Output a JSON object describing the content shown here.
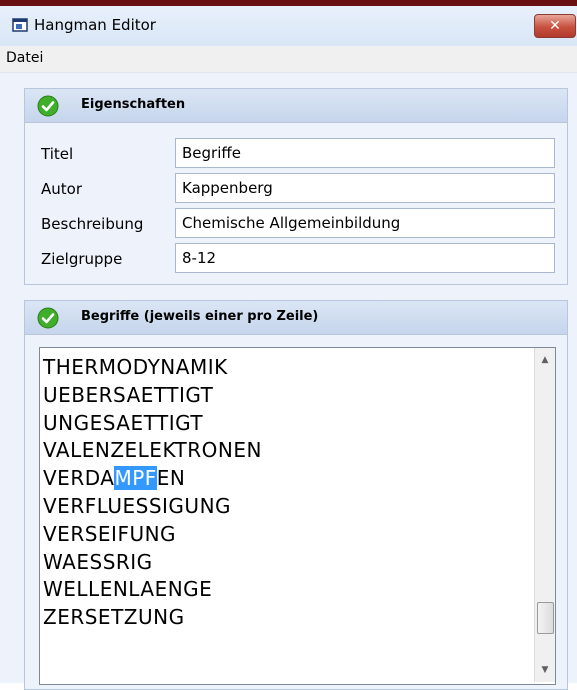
{
  "window": {
    "title": "Hangman Editor",
    "close_glyph": "✕",
    "icon": "app-icon"
  },
  "menu": {
    "items": [
      "Datei"
    ]
  },
  "properties": {
    "header": "Eigenschaften",
    "fields": [
      {
        "label": "Titel",
        "value": "Begriffe"
      },
      {
        "label": "Autor",
        "value": "Kappenberg"
      },
      {
        "label": "Beschreibung",
        "value": "Chemische Allgemeinbildung"
      },
      {
        "label": "Zielgruppe",
        "value": "8-12"
      }
    ]
  },
  "terms": {
    "header": "Begriffe (jeweils einer pro Zeile)",
    "items": [
      "THERMODYNAMIK",
      "UEBERSAETTIGT",
      "UNGESAETTIGT",
      "VALENZELEKTRONEN",
      "VERDAMPFEN",
      "VERFLUESSIGUNG",
      "VERSEIFUNG",
      "WAESSRIG",
      "WELLENLAENGE",
      "ZERSETZUNG"
    ],
    "selection": {
      "before": "VERDA",
      "selected": "MPF",
      "after": "EN"
    }
  },
  "colors": {
    "check_icon": "#3fae2a",
    "selection": "#3399ff",
    "close_button": "#c8503f"
  }
}
